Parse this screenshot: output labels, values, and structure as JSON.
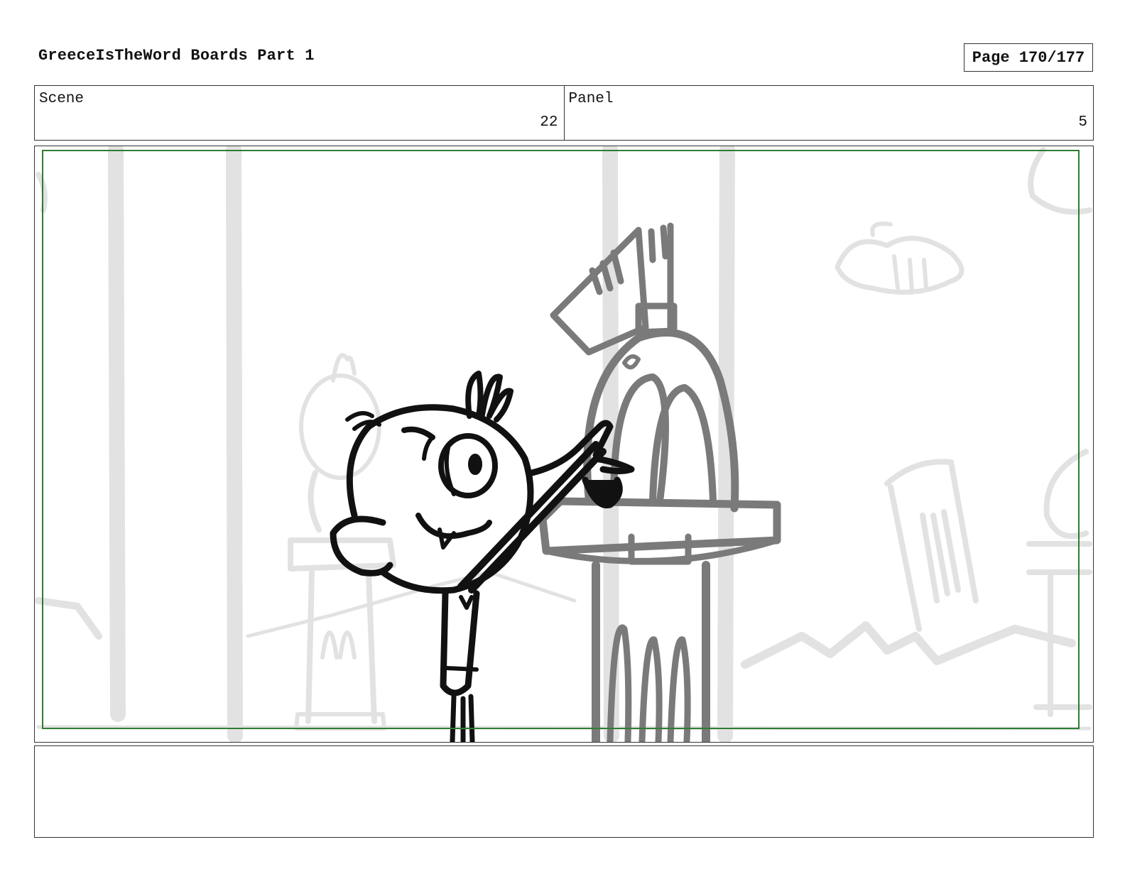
{
  "header": {
    "title": "GreeceIsTheWord Boards Part 1",
    "page_label": "Page 170/177"
  },
  "info": {
    "scene_label": "Scene",
    "scene_value": "22",
    "panel_label": "Panel",
    "panel_value": "5"
  },
  "frame": {
    "safe_area_color": "#2e7d32",
    "background_line_color": "#e2e2e2",
    "midground_line_color": "#7a7a7a",
    "character_line_color": "#111111"
  },
  "notes": {
    "text": ""
  }
}
